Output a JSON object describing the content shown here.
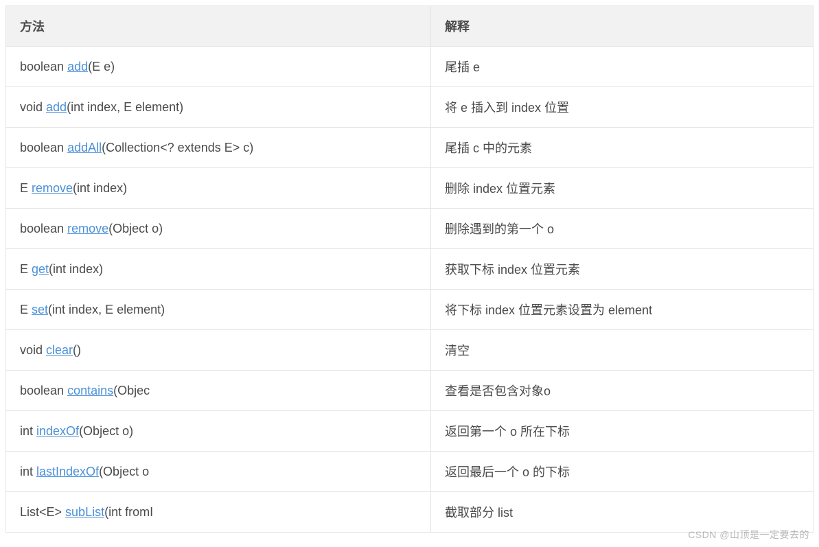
{
  "table": {
    "headers": {
      "method": "方法",
      "description": "解释"
    },
    "rows": [
      {
        "pre": "boolean ",
        "link": "add",
        "post": "(E e)",
        "desc": "尾插 e"
      },
      {
        "pre": "void ",
        "link": "add",
        "post": "(int index, E element)",
        "desc": "将 e 插入到 index 位置"
      },
      {
        "pre": "boolean ",
        "link": "addAll",
        "post": "(Collection<? extends E> c)",
        "desc": "尾插 c 中的元素"
      },
      {
        "pre": "E ",
        "link": "remove",
        "post": "(int index)",
        "desc": "删除 index 位置元素"
      },
      {
        "pre": "boolean ",
        "link": "remove",
        "post": "(Object o)",
        "desc": "删除遇到的第一个 o"
      },
      {
        "pre": "E ",
        "link": "get",
        "post": "(int index)",
        "desc": "获取下标 index 位置元素"
      },
      {
        "pre": "E ",
        "link": "set",
        "post": "(int index, E element)",
        "desc": "将下标 index 位置元素设置为 element"
      },
      {
        "pre": "void ",
        "link": "clear",
        "post": "()",
        "desc": "清空"
      },
      {
        "pre": "boolean ",
        "link": "contains",
        "post": "(Objec",
        "desc": "查看是否包含对象o"
      },
      {
        "pre": "int ",
        "link": "indexOf",
        "post": "(Object o)",
        "desc": "返回第一个 o 所在下标"
      },
      {
        "pre": "int ",
        "link": "lastIndexOf",
        "post": "(Object o",
        "desc": "返回最后一个 o 的下标"
      },
      {
        "pre": "List<E> ",
        "link": "subList",
        "post": "(int fromI",
        "desc": "截取部分 list"
      }
    ]
  },
  "watermark": "CSDN @山顶是一定要去的"
}
